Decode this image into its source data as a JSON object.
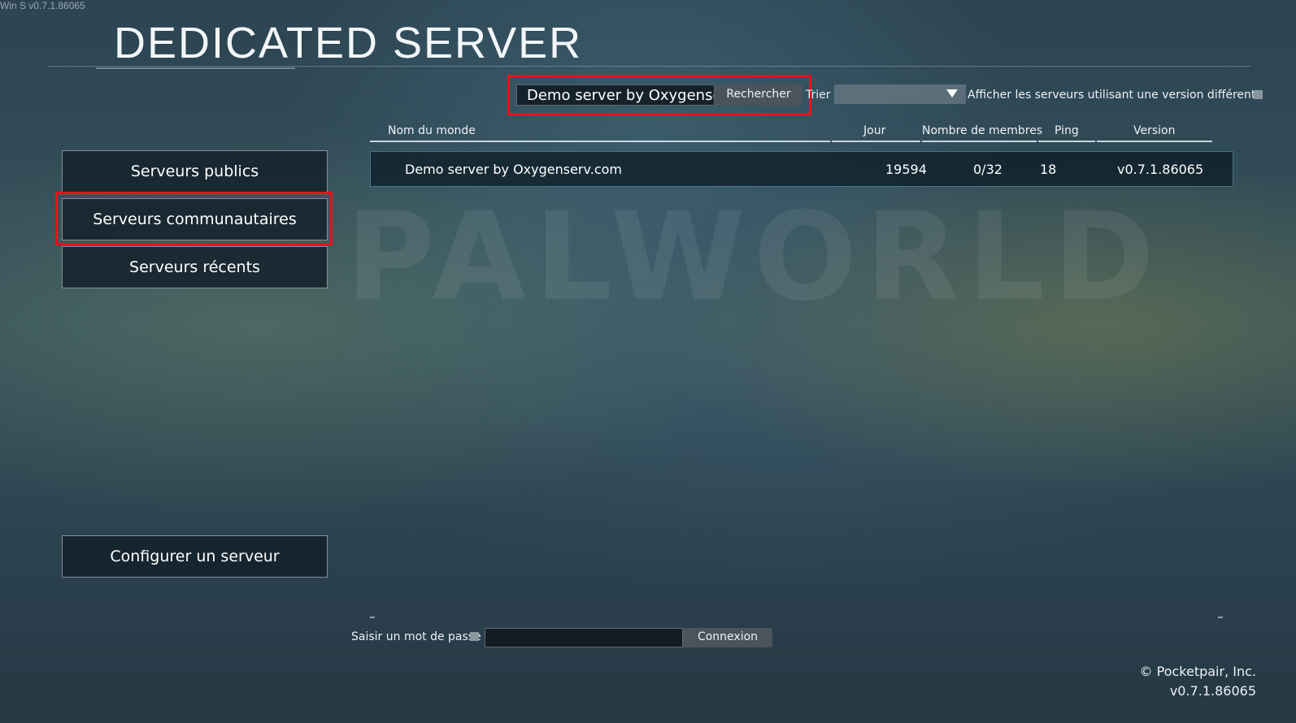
{
  "build_tag": "Win S v0.7.1.86065",
  "watermark": "PALWORLD",
  "title": "DEDICATED SERVER",
  "search": {
    "value": "Demo server by Oxygenserv.com",
    "button": "Rechercher"
  },
  "sort": {
    "label": "Trier",
    "selected": ""
  },
  "show_diff_version": {
    "label": "Afficher les serveurs utilisant une version différente",
    "checked": false
  },
  "table": {
    "columns": [
      "Nom du monde",
      "Jour",
      "Nombre de membres",
      "Ping",
      "Version"
    ],
    "rows": [
      {
        "name": "Demo server by Oxygenserv.com",
        "day": "19594",
        "members": "0/32",
        "ping": "18",
        "version": "v0.7.1.86065"
      }
    ]
  },
  "sidebar": {
    "items": [
      {
        "label": "Serveurs publics"
      },
      {
        "label": "Serveurs communautaires",
        "active": true
      },
      {
        "label": "Serveurs récents"
      }
    ],
    "configure": "Configurer un serveur"
  },
  "password": {
    "label": "Saisir un mot de passe",
    "value": "",
    "connect": "Connexion"
  },
  "footer": {
    "copyright": "© Pocketpair, Inc.",
    "version": "v0.7.1.86065"
  },
  "colors": {
    "highlight": "#e8121b",
    "button": "#4a545b"
  }
}
